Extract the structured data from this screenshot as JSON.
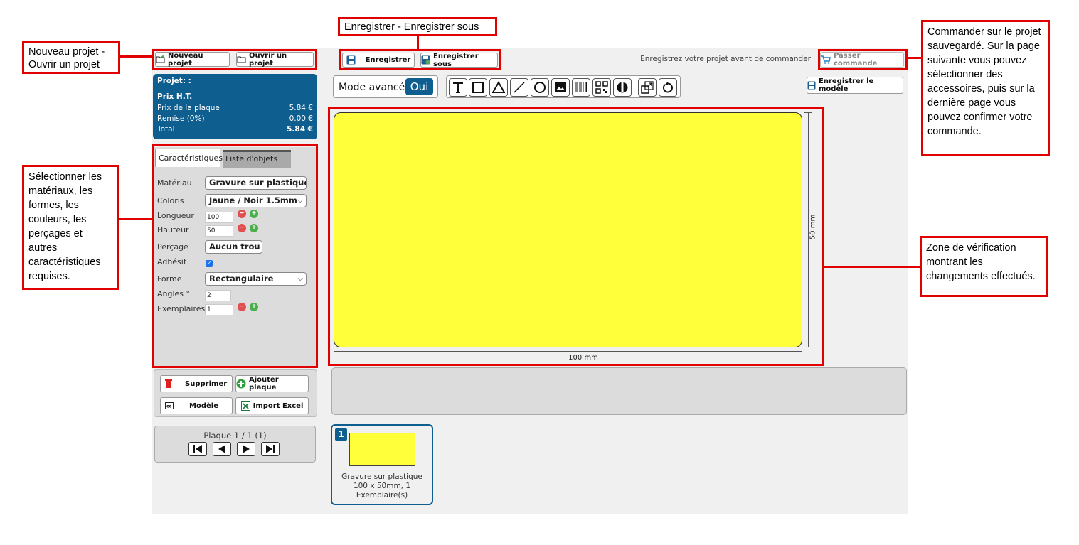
{
  "callouts": {
    "new_open": "Nouveau projet - Ouvrir un projet",
    "save": "Enregistrer - Enregistrer sous",
    "order": "Commander sur le projet sauvegardé. Sur la page suivante vous pouvez sélectionner des accessoires, puis sur la dernière page vous pouvez confirmer votre commande.",
    "select": "Sélectionner les matériaux, les formes, les couleurs, les perçages et autres caractéristiques requises.",
    "zone": "Zone de vérification montrant les changements effectués."
  },
  "toolbar": {
    "new_label": "Nouveau projet",
    "open_label": "Ouvrir un projet",
    "save_label": "Enregistrer",
    "save_as_label": "Enregistrer sous",
    "order_hint": "Enregistrez votre projet avant de commander",
    "order_label": "Passer commande"
  },
  "project": {
    "title": "Projet: :",
    "price_heading": "Prix H.T.",
    "rows": [
      {
        "label": "Prix de la plaque",
        "value": "5.84 €"
      },
      {
        "label": "Remise (0%)",
        "value": "0.00 €"
      }
    ],
    "total_label": "Total",
    "total_value": "5.84 €"
  },
  "tabs": [
    {
      "label": "Caractéristiques",
      "active": true
    },
    {
      "label": "Liste d'objets",
      "active": false
    }
  ],
  "form": {
    "material_label": "Matériau",
    "material_value": "Gravure sur plastique",
    "color_label": "Coloris",
    "color_value": "Jaune / Noir 1.5mm",
    "length_label": "Longueur",
    "length_value": "100",
    "height_label": "Hauteur",
    "height_value": "50",
    "drill_label": "Perçage",
    "drill_value": "Aucun trou",
    "adhesive_label": "Adhésif",
    "adhesive_checked": true,
    "shape_label": "Forme",
    "shape_value": "Rectangulaire",
    "angles_label": "Angles °",
    "angles_value": "2",
    "copies_label": "Exemplaires",
    "copies_value": "1"
  },
  "actions": {
    "delete_label": "Supprimer",
    "add_label": "Ajouter plaque",
    "model_label": "Modèle",
    "import_label": "Import Excel"
  },
  "pager": {
    "label": "Plaque 1 / 1 (1)"
  },
  "editor": {
    "mode_label": "Mode avancé",
    "mode_value": "Oui",
    "tools": [
      "text-tool-icon",
      "rectangle-tool-icon",
      "triangle-tool-icon",
      "line-tool-icon",
      "circle-tool-icon",
      "image-tool-icon",
      "barcode-tool-icon",
      "qrcode-tool-icon",
      "symbol-tool-icon",
      "resize-tool-icon",
      "undo-tool-icon"
    ],
    "save_model_label": "Enregistrer le modèle",
    "plate_color": "#ffff3a",
    "width_label": "100 mm",
    "height_label": "50 mm"
  },
  "thumbnail": {
    "number": "1",
    "caption": "Gravure sur plastique 100 x 50mm, 1 Exemplaire(s)"
  },
  "colors": {
    "accent": "#0e5e8f",
    "highlight": "#e00000",
    "plate": "#ffff3a"
  }
}
